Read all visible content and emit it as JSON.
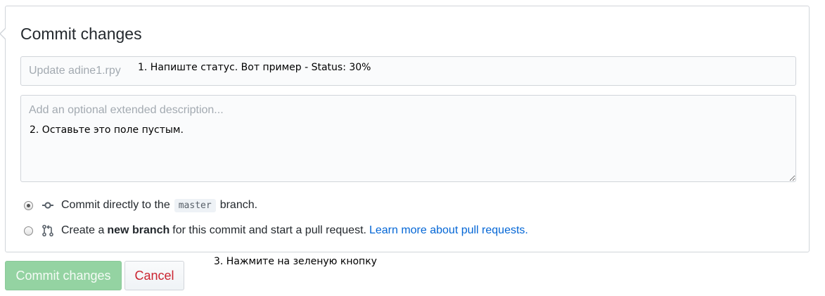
{
  "form": {
    "title": "Commit changes",
    "summary_placeholder": "Update adine1.rpy",
    "summary_value": "",
    "description_placeholder": "Add an optional extended description...",
    "description_value": ""
  },
  "annotations": {
    "step1": "1. Напиште статус. Вот пример - Status: 30%",
    "step2": "2. Оставьте это поле пустым.",
    "step3": "3. Нажмите на зеленую кнопку"
  },
  "options": {
    "direct": {
      "selected": true,
      "text_before": "Commit directly to the",
      "branch": "master",
      "text_after": "branch.",
      "icon": "git-commit-icon"
    },
    "new_branch": {
      "selected": false,
      "text_before": "Create a",
      "bold": "new branch",
      "text_after": "for this commit and start a pull request.",
      "link": "Learn more about pull requests.",
      "icon": "git-pull-request-icon"
    }
  },
  "buttons": {
    "commit": "Commit changes",
    "cancel": "Cancel"
  },
  "colors": {
    "commit_button_bg": "#94d3a2",
    "cancel_text": "#cb2431",
    "link": "#0366d6"
  }
}
